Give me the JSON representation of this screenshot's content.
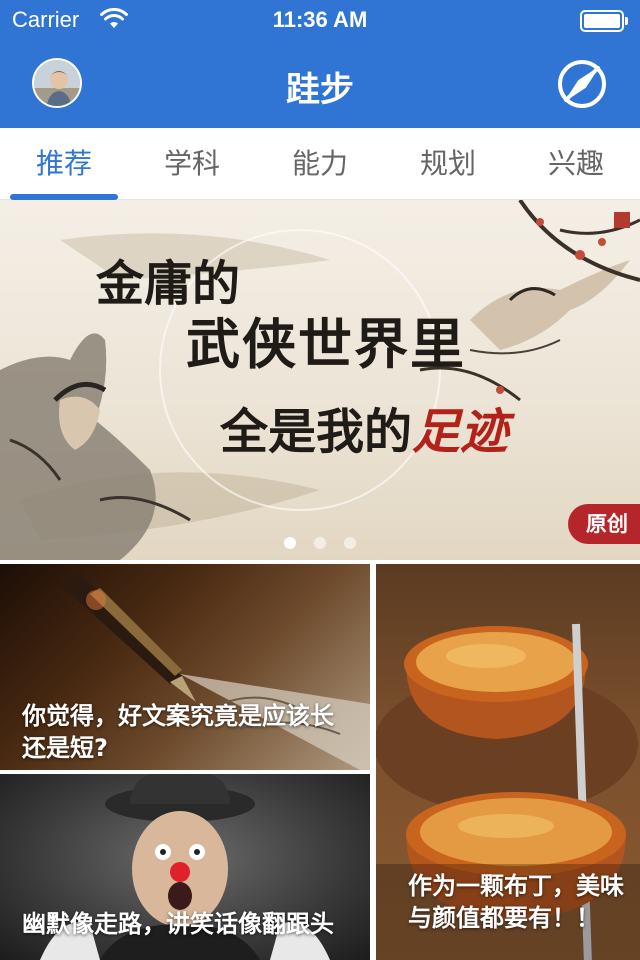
{
  "status_bar": {
    "carrier": "Carrier",
    "time": "11:36 AM"
  },
  "header": {
    "title": "跬步",
    "avatar_icon": "avatar-photo",
    "right_icon": "compass-icon"
  },
  "tabs": [
    {
      "label": "推荐",
      "active": true
    },
    {
      "label": "学科",
      "active": false
    },
    {
      "label": "能力",
      "active": false
    },
    {
      "label": "规划",
      "active": false
    },
    {
      "label": "兴趣",
      "active": false
    }
  ],
  "banner": {
    "line1": "金庸的",
    "line2": "武侠世界里",
    "line3_a": "全是我的",
    "line3_b": "足迹",
    "badge": "原创",
    "page_count": 3,
    "current_page": 1
  },
  "cards": [
    {
      "caption": "你觉得，好文案究竟是应该长还是短?"
    },
    {
      "caption": "幽默像走路，讲笑话像翻跟头"
    },
    {
      "caption": "作为一颗布丁，美味与颜值都要有！！"
    }
  ],
  "colors": {
    "primary": "#3175d4",
    "badge": "#b5262a"
  }
}
